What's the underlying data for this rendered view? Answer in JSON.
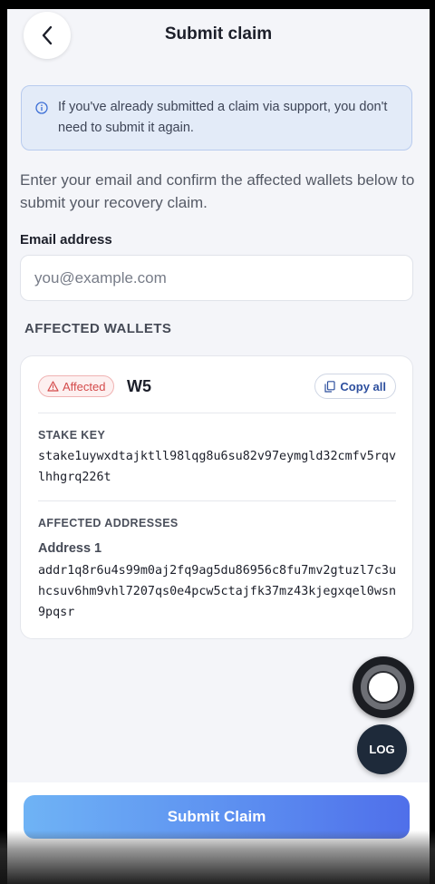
{
  "header": {
    "title": "Submit claim",
    "back_icon": "chevron-left-icon"
  },
  "info_banner": {
    "icon": "info-icon",
    "text": "If you've already submitted a claim via support, you don't need to submit it again."
  },
  "intro": "Enter your email and confirm the affected wallets below to submit your recovery claim.",
  "email": {
    "label": "Email address",
    "value": "",
    "placeholder": "you@example.com"
  },
  "wallets": {
    "heading": "AFFECTED WALLETS",
    "items": [
      {
        "badge": "Affected",
        "badge_icon": "warning-triangle-icon",
        "name": "W5",
        "copy_all_label": "Copy all",
        "copy_icon": "copy-icon",
        "stake_key_label": "STAKE KEY",
        "stake_key": "stake1uywxdtajktll98lqg8u6su82v97eymgld32cmfv5rqvlhhgrq226t",
        "addresses_label": "AFFECTED ADDRESSES",
        "addresses": [
          {
            "label": "Address 1",
            "value": "addr1q8r6u4s99m0aj2fq9ag5du86956c8fu7mv2gtuzl7c3uhcsuv6hm9vhl7207qs0e4pcw5ctajfk37mz43kjegxqel0wsn9pqsr"
          }
        ]
      }
    ]
  },
  "floating": {
    "record_icon": "record-icon",
    "log_label": "LOG"
  },
  "footer": {
    "submit_label": "Submit Claim"
  },
  "colors": {
    "accent": "#5b8cf0",
    "banner_bg": "#e3ebf8",
    "badge_red": "#d44a4a",
    "background": "#f4f5f9"
  }
}
